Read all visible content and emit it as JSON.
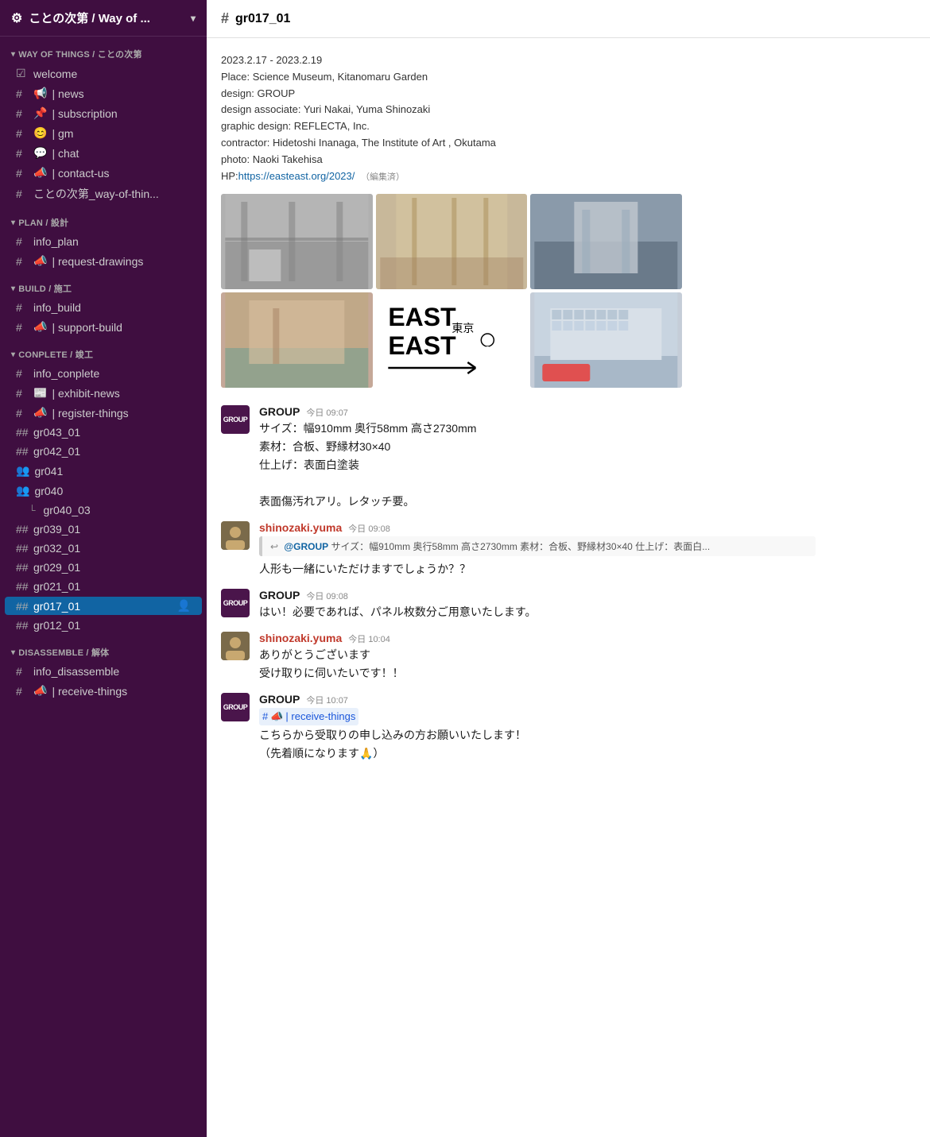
{
  "sidebar": {
    "workspace": "ことの次第 / Way of ...",
    "header_icon": "⚙",
    "chevron": "▾",
    "sections": [
      {
        "label": "WAY OF THINGS / ことの次第",
        "items": [
          {
            "prefix": "☑",
            "label": "welcome",
            "type": "check"
          },
          {
            "prefix": "#",
            "emoji": "📢",
            "label": "| news",
            "type": "channel"
          },
          {
            "prefix": "#",
            "emoji": "📌",
            "label": "| subscription",
            "type": "channel"
          },
          {
            "prefix": "#",
            "emoji": "😊",
            "label": "| gm",
            "type": "channel"
          },
          {
            "prefix": "#",
            "emoji": "💬",
            "label": "| chat",
            "type": "channel"
          },
          {
            "prefix": "#",
            "emoji": "📣",
            "label": "| contact-us",
            "type": "channel"
          },
          {
            "prefix": "#",
            "label": "ことの次第_way-of-thin...",
            "type": "channel"
          }
        ]
      },
      {
        "label": "PLAN / 設計",
        "items": [
          {
            "prefix": "#",
            "label": "info_plan",
            "type": "channel"
          },
          {
            "prefix": "#",
            "emoji": "📣",
            "label": "| request-drawings",
            "type": "channel"
          }
        ]
      },
      {
        "label": "BUILD / 施工",
        "items": [
          {
            "prefix": "#",
            "label": "info_build",
            "type": "channel"
          },
          {
            "prefix": "#",
            "emoji": "📣",
            "label": "| support-build",
            "type": "channel"
          }
        ]
      },
      {
        "label": "CONPLETE / 竣工",
        "items": [
          {
            "prefix": "#",
            "label": "info_conplete",
            "type": "channel"
          },
          {
            "prefix": "#",
            "emoji": "📰",
            "label": "| exhibit-news",
            "type": "channel"
          },
          {
            "prefix": "#",
            "emoji": "📣",
            "label": "| register-things",
            "type": "channel"
          },
          {
            "prefix": "##",
            "label": "gr043_01",
            "type": "group"
          },
          {
            "prefix": "##",
            "label": "gr042_01",
            "type": "group"
          },
          {
            "prefix": "👥",
            "label": "gr041",
            "type": "people"
          },
          {
            "prefix": "👥",
            "label": "gr040",
            "type": "people"
          },
          {
            "prefix": "└",
            "label": "gr040_03",
            "type": "sub"
          },
          {
            "prefix": "##",
            "label": "gr039_01",
            "type": "group"
          },
          {
            "prefix": "##",
            "label": "gr032_01",
            "type": "group"
          },
          {
            "prefix": "##",
            "label": "gr029_01",
            "type": "group"
          },
          {
            "prefix": "##",
            "label": "gr021_01",
            "type": "group"
          },
          {
            "prefix": "##",
            "label": "gr017_01",
            "type": "group",
            "active": true
          },
          {
            "prefix": "##",
            "label": "gr012_01",
            "type": "group"
          }
        ]
      },
      {
        "label": "DISASSEMBLE / 解体",
        "items": [
          {
            "prefix": "#",
            "label": "info_disassemble",
            "type": "channel"
          },
          {
            "prefix": "#",
            "emoji": "📣",
            "label": "| receive-things",
            "type": "channel"
          }
        ]
      }
    ]
  },
  "main": {
    "channel_name": "gr017_01",
    "info": {
      "dates": "2023.2.17 - 2023.2.19",
      "place": "Place: Science Museum, Kitanomaru Garden",
      "design": "design: GROUP",
      "design_associate": "design associate: Yuri Nakai, Yuma Shinozaki",
      "graphic_design": "graphic design: REFLECTA, Inc.",
      "contractor": "contractor: Hidetoshi Inanaga, The Institute of Art , Okutama",
      "photo": "photo: Naoki Takehisa",
      "hp_label": "HP:",
      "hp_url": "https://easteast.org/2023/",
      "edit_badge": "（編集済）"
    },
    "messages": [
      {
        "id": "msg1",
        "author": "GROUP",
        "author_type": "group",
        "time": "今日 09:07",
        "lines": [
          "サイズ：幅910mm 奥行58mm 高さ2730mm",
          "素材：合板、野縁材30×40",
          "仕上げ：表面白塗装",
          "",
          "表面傷汚れアリ。レタッチ要。"
        ]
      },
      {
        "id": "msg2",
        "author": "shinozaki.yuma",
        "author_type": "shinozaki",
        "time": "今日 09:08",
        "has_quote": true,
        "quote_text": "@GROUP サイズ：幅910mm 奥行58mm 高さ2730mm 素材：合板、野縁材30×40 仕上げ：表面白",
        "lines": [
          "人形も一緒にいただけますでしょうか？？"
        ]
      },
      {
        "id": "msg3",
        "author": "GROUP",
        "author_type": "group",
        "time": "今日 09:08",
        "lines": [
          "はい！必要であれば、パネル枚数分ご用意いたします。"
        ]
      },
      {
        "id": "msg4",
        "author": "shinozaki.yuma",
        "author_type": "shinozaki",
        "time": "今日 10:04",
        "lines": [
          "ありがとうございます",
          "受け取りに伺いたいです！！"
        ]
      },
      {
        "id": "msg5",
        "author": "GROUP",
        "author_type": "group",
        "time": "今日 10:07",
        "has_tag": true,
        "tag_text": "# 📣 | receive-things",
        "lines": [
          "こちらから受取りの申し込みの方お願いいたします！",
          "（先着順になります🙏）"
        ]
      }
    ]
  }
}
